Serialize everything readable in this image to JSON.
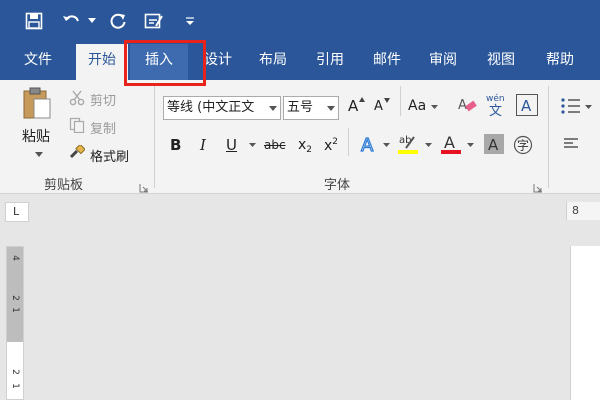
{
  "quick_access": {
    "icons": [
      "save-icon",
      "undo-icon",
      "repeat-icon",
      "touch-mode-icon",
      "customize-qat-icon"
    ]
  },
  "tabs": [
    {
      "label": "文件"
    },
    {
      "label": "开始"
    },
    {
      "label": "插入"
    },
    {
      "label": "设计"
    },
    {
      "label": "布局"
    },
    {
      "label": "引用"
    },
    {
      "label": "邮件"
    },
    {
      "label": "审阅"
    },
    {
      "label": "视图"
    },
    {
      "label": "帮助"
    }
  ],
  "clipboard": {
    "paste": "粘贴",
    "cut": "剪切",
    "copy": "复制",
    "format_painter": "格式刷",
    "group_label": "剪贴板"
  },
  "font": {
    "font_name": "等线 (中文正文",
    "font_size": "五号",
    "group_label": "字体",
    "bold": "B",
    "italic": "I",
    "underline": "U",
    "strike": "abc",
    "subscript": "x",
    "superscript": "x",
    "grow": "A",
    "shrink": "A",
    "case": "Aa",
    "phonetic_top": "wén",
    "phonetic_bottom": "文",
    "text_effect": "A",
    "highlight_top": "ab",
    "font_color": "A",
    "shading": "A",
    "enclose": "字",
    "border_char": "A"
  },
  "ruler": {
    "corner_mark": "L",
    "hruler_number": "8",
    "vruler_labels": [
      "4",
      "2",
      "1",
      "2",
      "1"
    ]
  },
  "colors": {
    "brand": "#2b579a",
    "highlight_box": "#e8231b",
    "font_color_bar": "#e81123",
    "highlight_bar": "#ffff00"
  }
}
